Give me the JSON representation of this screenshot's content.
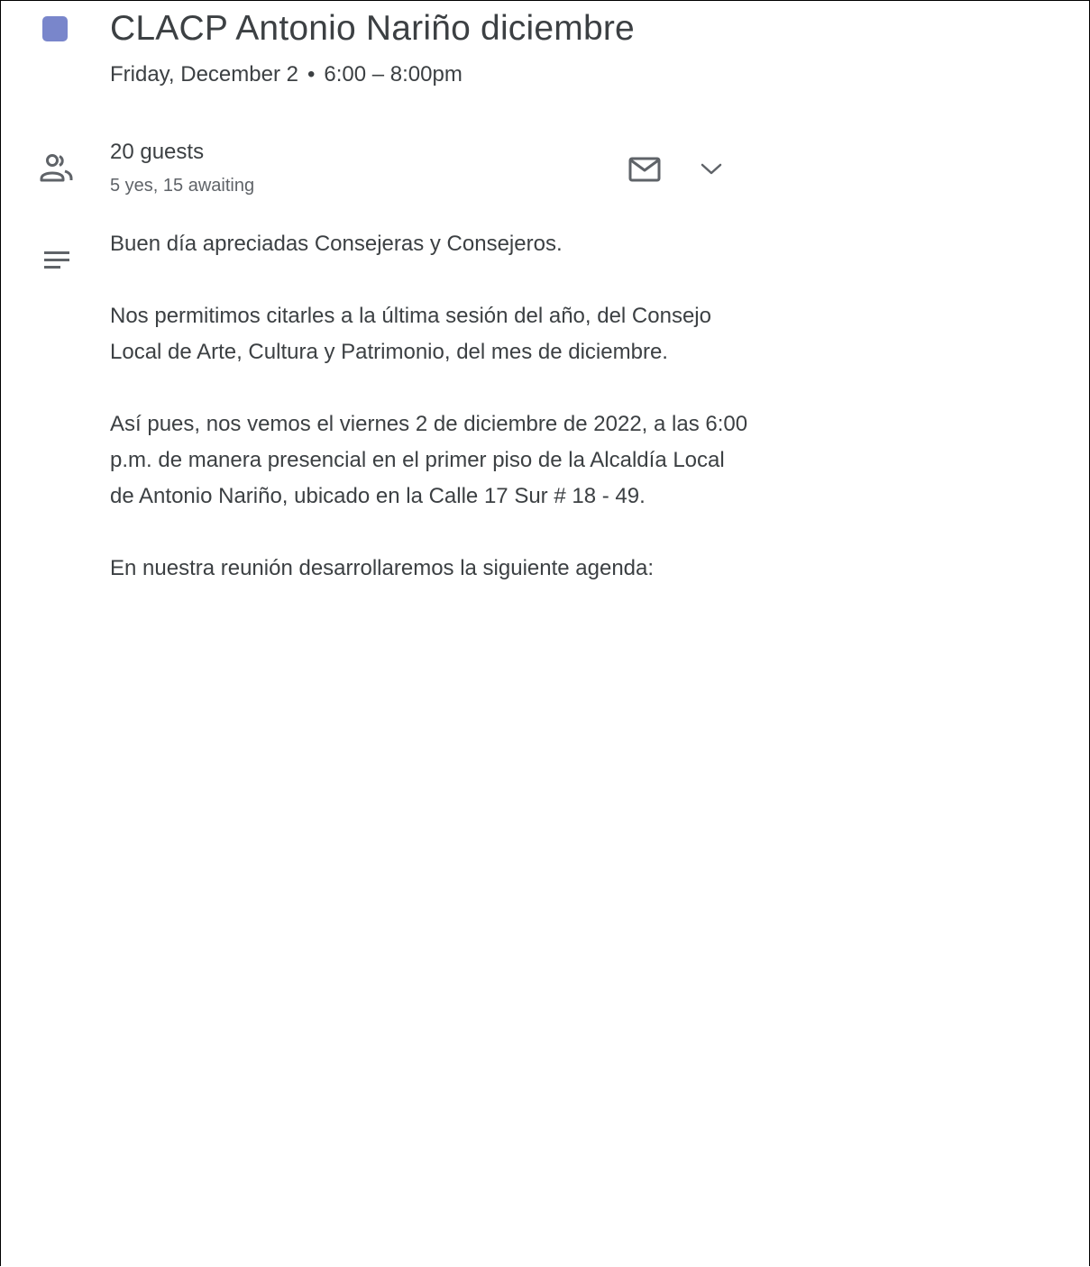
{
  "event": {
    "color": "#7986cb",
    "title": "CLACP Antonio Nariño diciembre",
    "date": "Friday, December 2",
    "separator": "•",
    "time": "6:00 – 8:00pm"
  },
  "guests": {
    "icon": "people-icon",
    "count_label": "20 guests",
    "summary": "5 yes, 15 awaiting",
    "email_icon": "mail-icon",
    "expand_icon": "chevron-down-icon"
  },
  "description": {
    "icon": "notes-icon",
    "paragraphs": [
      "Buen día apreciadas Consejeras y Consejeros.",
      "Nos permitimos citarles a la última sesión del año, del Consejo Local de Arte, Cultura y Patrimonio, del mes de diciembre.",
      "Así pues, nos vemos el viernes 2 de diciembre de 2022, a las 6:00 p.m. de manera presencial en el primer piso de la Alcaldía Local de Antonio Nariño, ubicado en la Calle 17 Sur # 18 - 49.",
      "En nuestra reunión desarrollaremos la siguiente agenda:"
    ]
  }
}
